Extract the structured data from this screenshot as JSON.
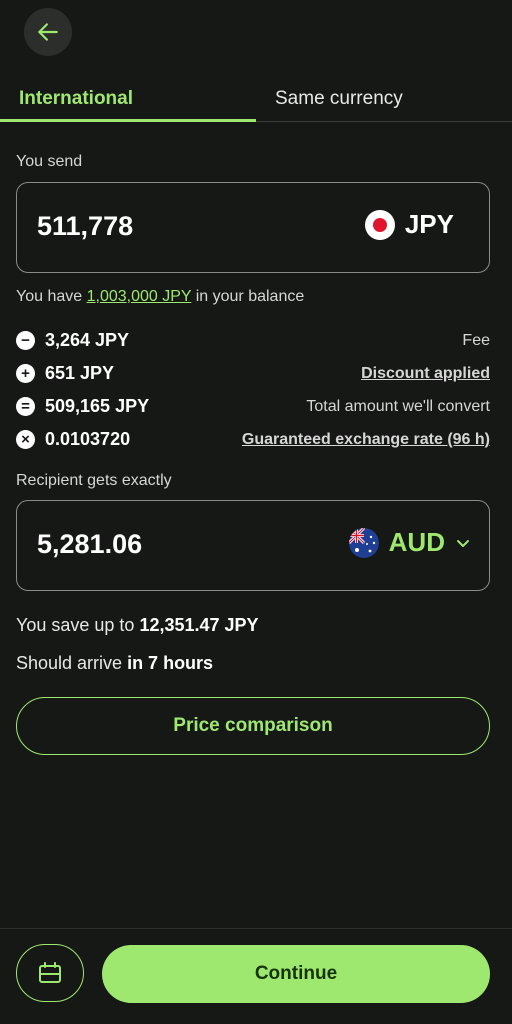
{
  "header": {
    "back_icon": "arrow-left-icon"
  },
  "tabs": [
    {
      "label": "International",
      "active": true
    },
    {
      "label": "Same currency",
      "active": false
    }
  ],
  "send": {
    "label": "You send",
    "amount": "511,778",
    "currency": "JPY",
    "flag": "japan-flag-icon"
  },
  "balance": {
    "prefix": "You have ",
    "amount": "1,003,000 JPY",
    "suffix": " in your balance"
  },
  "breakdown": [
    {
      "icon": "minus-circle-icon",
      "value": "3,264 JPY",
      "desc": "Fee",
      "link": false
    },
    {
      "icon": "plus-circle-icon",
      "value": "651 JPY",
      "desc": "Discount applied",
      "link": true
    },
    {
      "icon": "equals-circle-icon",
      "value": "509,165 JPY",
      "desc": "Total amount we'll convert",
      "link": false
    },
    {
      "icon": "times-circle-icon",
      "value": "0.0103720",
      "desc": "Guaranteed exchange rate (96 h)",
      "link": true
    }
  ],
  "receive": {
    "label": "Recipient gets exactly",
    "amount": "5,281.06",
    "currency": "AUD",
    "flag": "australia-flag-icon"
  },
  "savings": {
    "prefix": "You save up to ",
    "amount": "12,351.47 JPY"
  },
  "arrival": {
    "prefix": "Should arrive ",
    "eta": "in 7 hours"
  },
  "price_comparison_label": "Price comparison",
  "footer": {
    "calendar_icon": "calendar-icon",
    "continue_label": "Continue"
  },
  "colors": {
    "accent": "#9fe870",
    "background": "#161816",
    "button_text": "#163300"
  }
}
